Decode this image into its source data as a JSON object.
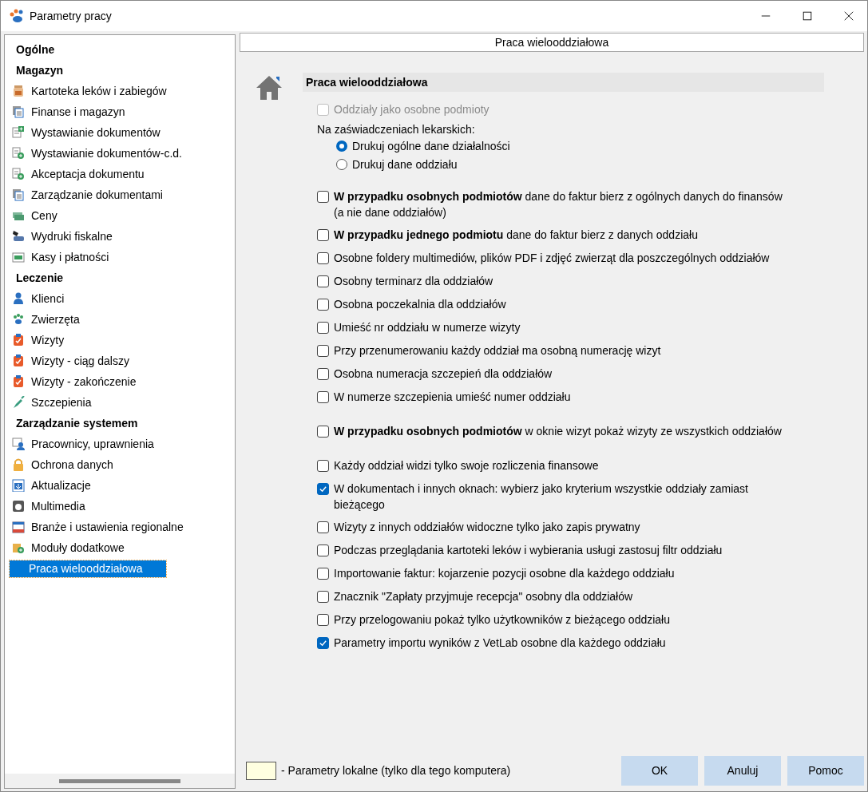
{
  "window": {
    "title": "Parametry pracy"
  },
  "sidebar": {
    "items": [
      {
        "label": "Ogólne",
        "selected": false
      },
      {
        "label": "Magazyn",
        "selected": false,
        "children": [
          {
            "label": "Kartoteka leków i zabiegów",
            "selected": false
          },
          {
            "label": "Finanse i magazyn",
            "selected": false
          },
          {
            "label": "Wystawianie dokumentów",
            "selected": false
          },
          {
            "label": "Wystawianie dokumentów-c.d.",
            "selected": false
          },
          {
            "label": "Akceptacja dokumentu",
            "selected": false
          },
          {
            "label": "Zarządzanie dokumentami",
            "selected": false
          },
          {
            "label": "Ceny",
            "selected": false
          },
          {
            "label": "Wydruki fiskalne",
            "selected": false
          },
          {
            "label": "Kasy i płatności",
            "selected": false
          }
        ]
      },
      {
        "label": "Leczenie",
        "selected": false,
        "children": [
          {
            "label": "Klienci",
            "selected": false
          },
          {
            "label": "Zwierzęta",
            "selected": false
          },
          {
            "label": "Wizyty",
            "selected": false
          },
          {
            "label": "Wizyty - ciąg dalszy",
            "selected": false
          },
          {
            "label": "Wizyty - zakończenie",
            "selected": false
          },
          {
            "label": "Szczepienia",
            "selected": false
          }
        ]
      },
      {
        "label": "Zarządzanie systemem",
        "selected": false,
        "children": [
          {
            "label": "Pracownicy, uprawnienia",
            "selected": false
          },
          {
            "label": "Ochrona danych",
            "selected": false
          },
          {
            "label": "Aktualizacje",
            "selected": false
          },
          {
            "label": "Multimedia",
            "selected": false
          },
          {
            "label": "Branże i ustawienia regionalne",
            "selected": false
          },
          {
            "label": "Moduły dodatkowe",
            "selected": false
          },
          {
            "label": "Praca wielooddziałowa",
            "selected": true
          }
        ]
      }
    ]
  },
  "page": {
    "header": "Praca wielooddziałowa",
    "section_title": "Praca wielooddziałowa",
    "groups": [
      [
        {
          "kind": "checkbox",
          "text": "Oddziały jako osobne podmioty",
          "checked": false,
          "disabled": true
        },
        {
          "kind": "label",
          "text": "Na zaświadczeniach lekarskich:"
        },
        {
          "kind": "radio",
          "text": "Drukuj ogólne dane działalności",
          "selected": true
        },
        {
          "kind": "radio",
          "text": "Drukuj dane oddziału",
          "selected": false
        }
      ],
      [
        {
          "kind": "checkbox",
          "text": "**W przypadku osobnych podmiotów** dane do faktur bierz z ogólnych danych do finansów (a nie dane oddziałów)",
          "checked": false,
          "disabled": false
        },
        {
          "kind": "checkbox",
          "text": "**W przypadku jednego podmiotu** dane do faktur bierz z danych oddziału",
          "checked": false,
          "disabled": false
        },
        {
          "kind": "checkbox",
          "text": "Osobne foldery multimediów, plików PDF i zdjęć zwierząt dla poszczególnych oddziałów",
          "checked": false,
          "disabled": false
        },
        {
          "kind": "checkbox",
          "text": "Osobny terminarz dla oddziałów",
          "checked": false,
          "disabled": false
        },
        {
          "kind": "checkbox",
          "text": "Osobna poczekalnia dla oddziałów",
          "checked": false,
          "disabled": false
        },
        {
          "kind": "checkbox",
          "text": "Umieść nr oddziału w numerze wizyty",
          "checked": false,
          "disabled": false
        },
        {
          "kind": "checkbox",
          "text": "Przy przenumerowaniu każdy oddział ma osobną numerację wizyt",
          "checked": false,
          "disabled": false
        },
        {
          "kind": "checkbox",
          "text": "Osobna numeracja szczepień dla oddziałów",
          "checked": false,
          "disabled": false
        },
        {
          "kind": "checkbox",
          "text": "W numerze szczepienia umieść numer oddziału",
          "checked": false,
          "disabled": false
        }
      ],
      [
        {
          "kind": "checkbox",
          "text": "**W przypadku osobnych podmiotów**  w oknie wizyt pokaż wizyty ze wszystkich oddziałów",
          "checked": false,
          "disabled": false
        }
      ],
      [
        {
          "kind": "checkbox",
          "text": "Każdy oddział widzi tylko swoje rozliczenia finansowe",
          "checked": false,
          "disabled": false
        },
        {
          "kind": "checkbox",
          "text": "W dokumentach i innych oknach: wybierz jako kryterium wszystkie oddziały zamiast bieżącego",
          "checked": true,
          "disabled": false
        },
        {
          "kind": "checkbox",
          "text": "Wizyty z innych oddziałów widoczne tylko jako zapis prywatny",
          "checked": false,
          "disabled": false
        },
        {
          "kind": "checkbox",
          "text": "Podczas przeglądania kartoteki leków i wybierania usługi zastosuj filtr oddziału",
          "checked": false,
          "disabled": false
        },
        {
          "kind": "checkbox",
          "text": "Importowanie faktur: kojarzenie pozycji osobne dla każdego oddziału",
          "checked": false,
          "disabled": false
        },
        {
          "kind": "checkbox",
          "text": "Znacznik \"Zapłaty przyjmuje recepcja\" osobny dla oddziałów",
          "checked": false,
          "disabled": false
        },
        {
          "kind": "checkbox",
          "text": "Przy przelogowaniu pokaż tylko użytkowników z bieżącego oddziału",
          "checked": false,
          "disabled": false
        },
        {
          "kind": "checkbox",
          "text": "Parametry importu wyników z VetLab osobne dla każdego oddziału",
          "checked": true,
          "disabled": false
        }
      ]
    ]
  },
  "footer": {
    "legend": "- Parametry lokalne (tylko dla tego komputera)",
    "buttons": [
      "OK",
      "Anuluj",
      "Pomoc"
    ]
  }
}
